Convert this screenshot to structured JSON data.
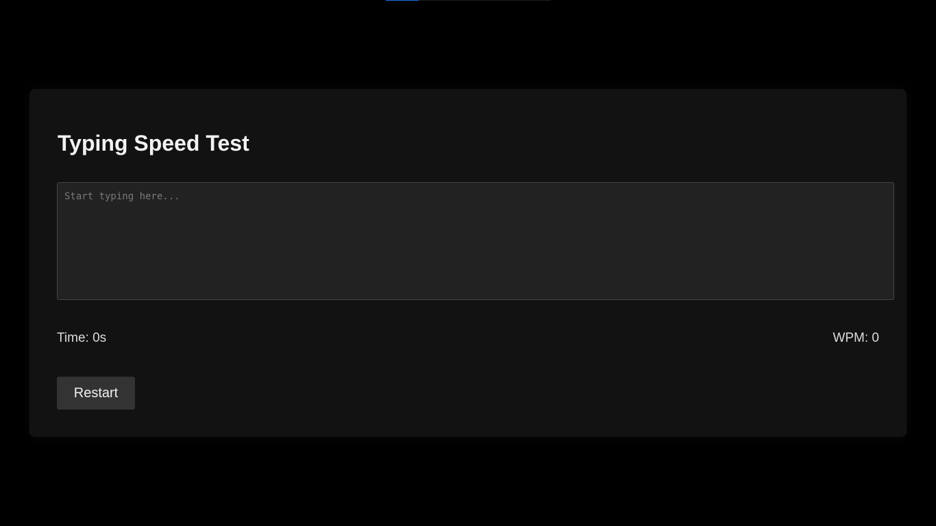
{
  "top_progress": {
    "value": 0.2,
    "color": "#1a73e8"
  },
  "app": {
    "title": "Typing Speed Test"
  },
  "input": {
    "placeholder": "Start typing here...",
    "value": ""
  },
  "stats": {
    "time_label": "Time: 0s",
    "wpm_label": "WPM: 0"
  },
  "controls": {
    "restart_label": "Restart"
  }
}
